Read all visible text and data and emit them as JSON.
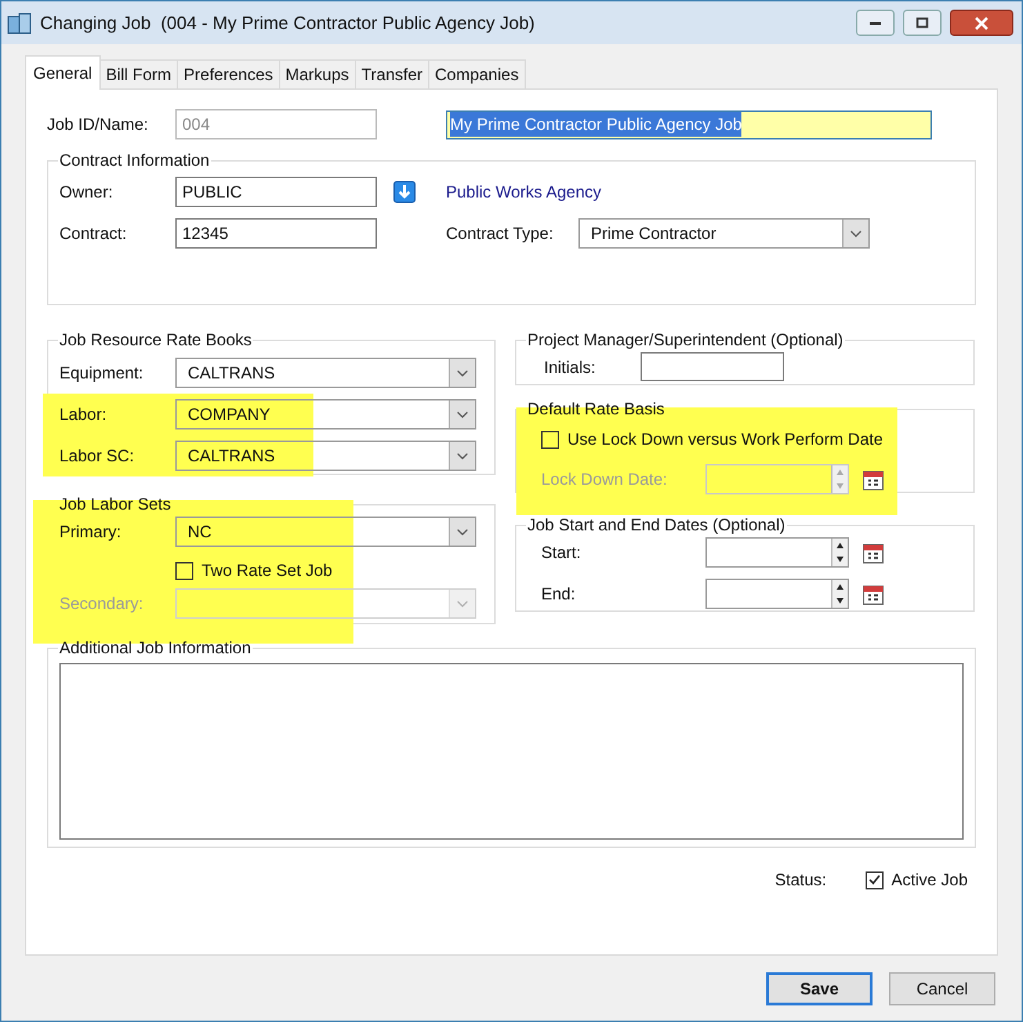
{
  "window": {
    "title": "Changing Job  (004 - My Prime Contractor Public Agency Job)"
  },
  "tabs": [
    {
      "label": "General",
      "selected": true
    },
    {
      "label": "Bill Form",
      "selected": false
    },
    {
      "label": "Preferences",
      "selected": false
    },
    {
      "label": "Markups",
      "selected": false
    },
    {
      "label": "Transfer",
      "selected": false
    },
    {
      "label": "Companies",
      "selected": false
    }
  ],
  "job": {
    "label": "Job ID/Name:",
    "id_value": "004",
    "id_disabled": true,
    "name_value": "My Prime Contractor Public Agency Job",
    "name_text_selected": true,
    "name_highlighted": true
  },
  "contract_information": {
    "title": "Contract Information",
    "owner": {
      "label": "Owner:",
      "value": "PUBLIC"
    },
    "owner_name": "Public Works Agency",
    "contract": {
      "label": "Contract:",
      "value": "12345"
    },
    "contract_type": {
      "label": "Contract Type:",
      "value": "Prime Contractor"
    }
  },
  "rate_books": {
    "title": "Job Resource Rate Books",
    "rows": [
      {
        "label": "Equipment:",
        "value": "CALTRANS",
        "highlighted": false
      },
      {
        "label": "Labor:",
        "value": "COMPANY",
        "highlighted": true
      },
      {
        "label": "Labor SC:",
        "value": "CALTRANS",
        "highlighted": true
      }
    ]
  },
  "labor_sets": {
    "title": "Job Labor Sets",
    "highlighted": true,
    "primary": {
      "label": "Primary:",
      "value": "NC"
    },
    "two_rate": {
      "label": "Two Rate Set Job",
      "checked": false
    },
    "secondary": {
      "label": "Secondary:",
      "disabled": true
    }
  },
  "project_manager": {
    "title": "Project Manager/Superintendent (Optional)",
    "initials": {
      "label": "Initials:"
    }
  },
  "default_rate_basis": {
    "title": "Default Rate Basis",
    "highlighted": true,
    "use_lock_down": {
      "label": "Use Lock Down versus Work Perform Date",
      "checked": false
    },
    "lock_down_date": {
      "label": "Lock Down Date:",
      "disabled": true
    }
  },
  "dates": {
    "title": "Job Start and End Dates (Optional)",
    "rows": [
      {
        "label": "Start:"
      },
      {
        "label": "End:"
      }
    ]
  },
  "additional_info": {
    "title": "Additional Job Information"
  },
  "status": {
    "label": "Status:",
    "active": {
      "label": "Active Job",
      "checked": true
    }
  },
  "buttons": [
    {
      "label": "Save",
      "default": true
    },
    {
      "label": "Cancel",
      "default": false
    }
  ]
}
